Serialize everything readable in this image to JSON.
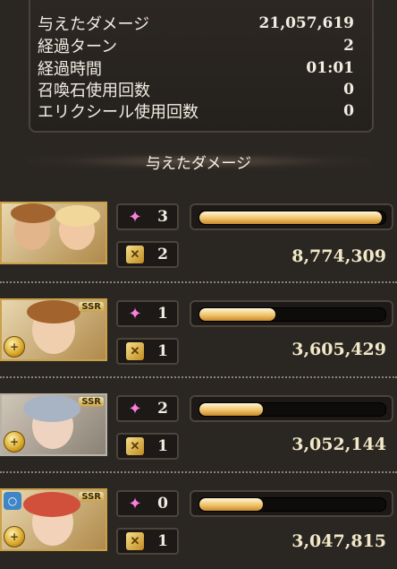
{
  "summary": {
    "rows": [
      {
        "label": "与えたダメージ",
        "value": "21,057,619"
      },
      {
        "label": "経過ターン",
        "value": "2"
      },
      {
        "label": "経過時間",
        "value": "01:01"
      },
      {
        "label": "召喚石使用回数",
        "value": "0"
      },
      {
        "label": "エリクシール使用回数",
        "value": "0"
      }
    ]
  },
  "section_title": "与えたダメージ",
  "characters": [
    {
      "skills": "3",
      "attacks": "2",
      "damage": "8,774,309",
      "share": 0.98,
      "rarity": "",
      "icons": [
        "sparkle-icon",
        "attack-icon"
      ]
    },
    {
      "skills": "1",
      "attacks": "1",
      "damage": "3,605,429",
      "share": 0.41,
      "rarity": "SSR",
      "icons": [
        "sparkle-icon",
        "attack-icon"
      ]
    },
    {
      "skills": "2",
      "attacks": "1",
      "damage": "3,052,144",
      "share": 0.34,
      "rarity": "SSR",
      "icons": [
        "sparkle-icon",
        "attack-icon"
      ]
    },
    {
      "skills": "0",
      "attacks": "1",
      "damage": "3,047,815",
      "share": 0.34,
      "rarity": "SSR",
      "icons": [
        "sparkle-icon",
        "attack-icon"
      ]
    }
  ],
  "colors": {
    "accent": "#f0c36a",
    "panel": "#1c1916",
    "background": "#2a2622"
  }
}
